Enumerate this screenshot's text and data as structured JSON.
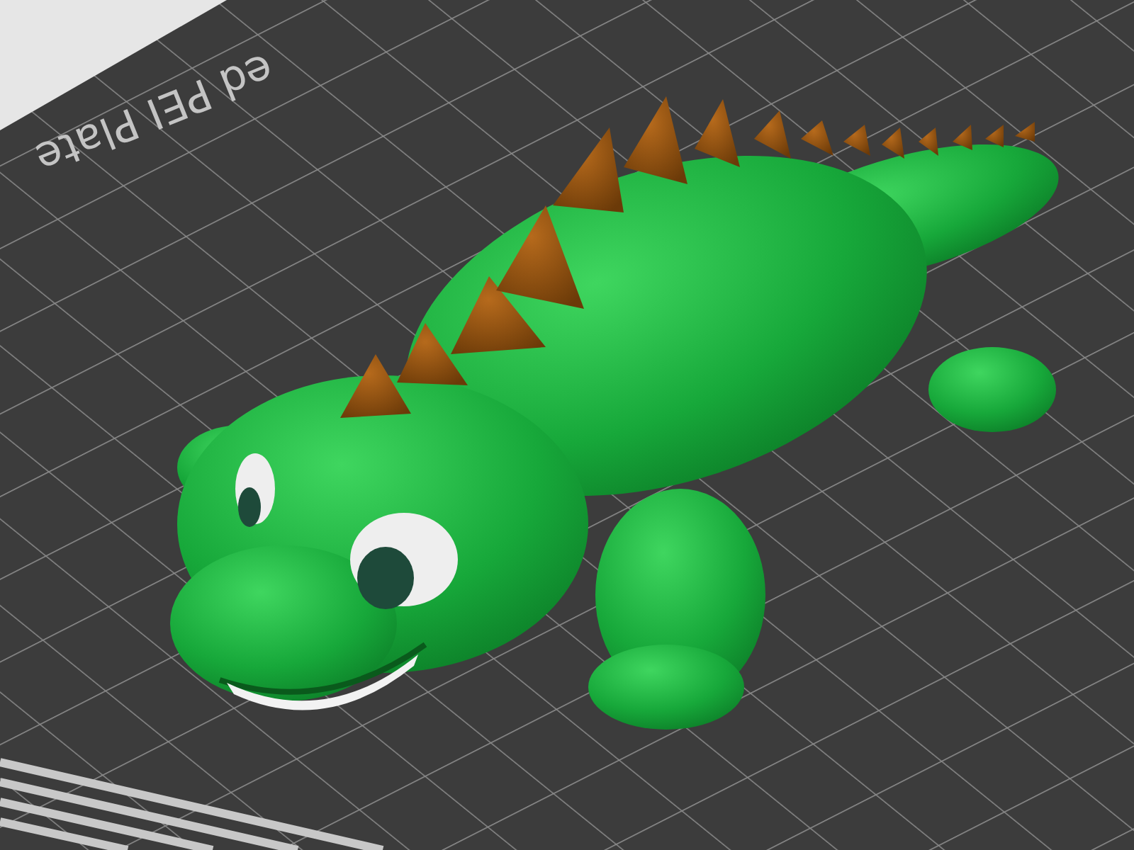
{
  "build_plate": {
    "label": "ed PEI Plate"
  }
}
